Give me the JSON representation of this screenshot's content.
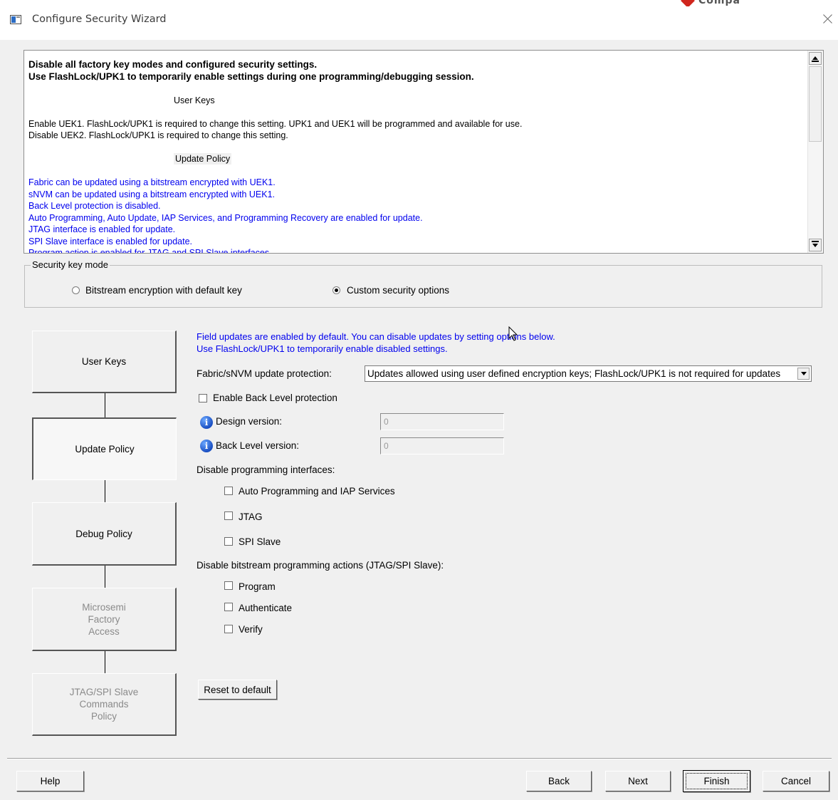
{
  "window": {
    "title": "Configure Security Wizard",
    "background_brand": "Compa"
  },
  "summary": {
    "lines": [
      {
        "text": "Disable all factory key modes and configured security settings.",
        "style": "head"
      },
      {
        "text": "Use FlashLock/UPK1 to temporarily enable settings during one programming/debugging session.",
        "style": "head"
      },
      {
        "text": "",
        "style": "blank"
      },
      {
        "text": "User Keys",
        "style": "center"
      },
      {
        "text": "",
        "style": "blank"
      },
      {
        "text": "Enable UEK1. FlashLock/UPK1 is required to change this setting. UPK1 and UEK1 will be programmed and available for use.",
        "style": "normal"
      },
      {
        "text": "Disable UEK2. FlashLock/UPK1 is required to change this setting.",
        "style": "normal"
      },
      {
        "text": "",
        "style": "blank"
      },
      {
        "text": "Update Policy",
        "style": "center-hl"
      },
      {
        "text": "",
        "style": "blank"
      },
      {
        "text": "Fabric can be updated using a bitstream encrypted with UEK1.",
        "style": "blue"
      },
      {
        "text": "sNVM can be updated using a bitstream encrypted with UEK1.",
        "style": "blue"
      },
      {
        "text": "Back Level protection is disabled.",
        "style": "blue"
      },
      {
        "text": "Auto Programming, Auto Update, IAP Services, and Programming Recovery are enabled for update.",
        "style": "blue"
      },
      {
        "text": "JTAG interface is enabled for update.",
        "style": "blue"
      },
      {
        "text": "SPI Slave interface is enabled for update.",
        "style": "blue"
      },
      {
        "text": "Program action is enabled for JTAG and SPI Slave interfaces.",
        "style": "blue"
      }
    ]
  },
  "key_mode": {
    "legend": "Security key mode",
    "option_default": "Bitstream encryption with default key",
    "option_custom": "Custom security options",
    "selected": "custom"
  },
  "steps": [
    {
      "label": "User Keys",
      "state": "normal"
    },
    {
      "label": "Update Policy",
      "state": "active"
    },
    {
      "label": "Debug Policy",
      "state": "normal"
    },
    {
      "label": "Microsemi\nFactory\nAccess",
      "state": "disabled"
    },
    {
      "label": "JTAG/SPI Slave\nCommands\nPolicy",
      "state": "disabled"
    }
  ],
  "panel": {
    "info_line1": "Field updates are enabled by default. You can disable updates by setting options below.",
    "info_line2": "Use FlashLock/UPK1 to temporarily enable disabled settings.",
    "protection_label": "Fabric/sNVM update protection:",
    "protection_value": "Updates allowed using user defined encryption keys; FlashLock/UPK1 is not required for updates",
    "back_level_label": "Enable Back Level protection",
    "back_level_checked": false,
    "design_version_label": "Design version:",
    "design_version_value": "0",
    "back_level_version_label": "Back Level version:",
    "back_level_version_value": "0",
    "interfaces_heading": "Disable programming interfaces:",
    "interfaces": [
      {
        "label": "Auto Programming and IAP Services",
        "checked": false
      },
      {
        "label": "JTAG",
        "checked": false
      },
      {
        "label": "SPI Slave",
        "checked": false
      }
    ],
    "actions_heading": "Disable bitstream programming actions (JTAG/SPI Slave):",
    "actions": [
      {
        "label": "Program",
        "checked": false
      },
      {
        "label": "Authenticate",
        "checked": false
      },
      {
        "label": "Verify",
        "checked": false
      }
    ],
    "reset_label": "Reset to default"
  },
  "footer": {
    "help": "Help",
    "back": "Back",
    "next": "Next",
    "finish": "Finish",
    "cancel": "Cancel"
  },
  "icons": {
    "app": "window-icon",
    "close": "close-icon",
    "info": "info-icon",
    "cursor": "mouse-cursor-icon"
  },
  "colors": {
    "info_text": "#0000ee",
    "background": "#f0f0f0",
    "brand_logo": "#d0261d"
  }
}
